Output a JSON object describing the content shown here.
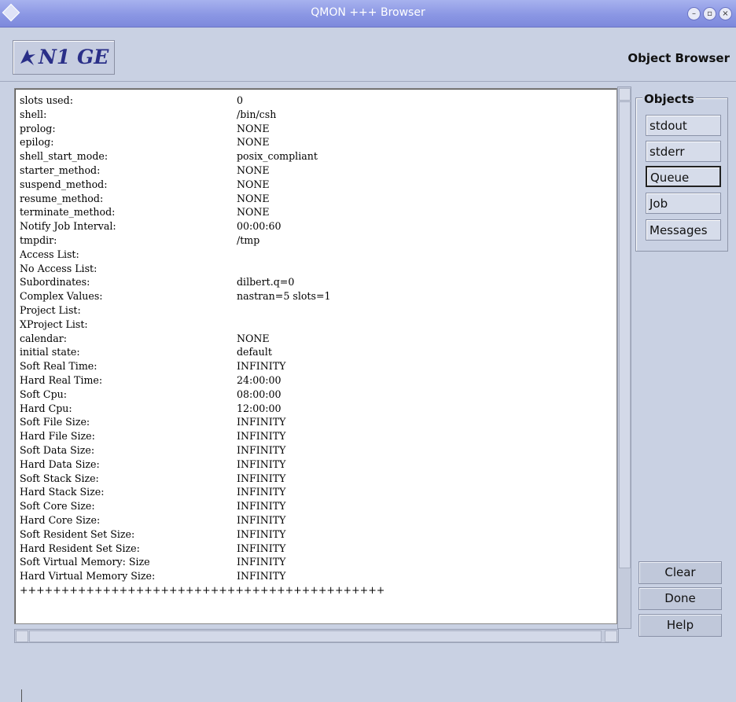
{
  "window": {
    "title": "QMON +++ Browser"
  },
  "header": {
    "logo_text": "N1 GE",
    "title": "Object Browser"
  },
  "content": {
    "lines": [
      [
        "slots used:",
        "0"
      ],
      [
        "shell:",
        "/bin/csh"
      ],
      [
        "prolog:",
        "NONE"
      ],
      [
        "epilog:",
        "NONE"
      ],
      [
        "shell_start_mode:",
        "posix_compliant"
      ],
      [
        "starter_method:",
        "NONE"
      ],
      [
        "suspend_method:",
        "NONE"
      ],
      [
        "resume_method:",
        "NONE"
      ],
      [
        "terminate_method:",
        "NONE"
      ],
      [
        "Notify Job Interval:",
        "00:00:60"
      ],
      [
        "tmpdir:",
        "/tmp"
      ],
      [
        "Access List:",
        ""
      ],
      [
        "No Access List:",
        ""
      ],
      [
        "Subordinates:",
        "dilbert.q=0"
      ],
      [
        "Complex Values:",
        "nastran=5 slots=1"
      ],
      [
        "Project List:",
        ""
      ],
      [
        "XProject List:",
        ""
      ],
      [
        "calendar:",
        "NONE"
      ],
      [
        "initial state:",
        "default"
      ],
      [
        "Soft Real Time:",
        "INFINITY"
      ],
      [
        "Hard Real Time:",
        "24:00:00"
      ],
      [
        "Soft Cpu:",
        "08:00:00"
      ],
      [
        "Hard Cpu:",
        "12:00:00"
      ],
      [
        "Soft File Size:",
        "INFINITY"
      ],
      [
        "Hard File Size:",
        "INFINITY"
      ],
      [
        "Soft Data Size:",
        "INFINITY"
      ],
      [
        "Hard Data Size:",
        "INFINITY"
      ],
      [
        "Soft Stack Size:",
        "INFINITY"
      ],
      [
        "Hard Stack Size:",
        "INFINITY"
      ],
      [
        "Soft Core Size:",
        "INFINITY"
      ],
      [
        "Hard Core Size:",
        "INFINITY"
      ],
      [
        "Soft Resident Set Size:",
        "INFINITY"
      ],
      [
        "Hard Resident Set Size:",
        "INFINITY"
      ],
      [
        "Soft Virtual Memory: Size",
        "INFINITY"
      ],
      [
        "Hard Virtual Memory Size:",
        "INFINITY"
      ],
      [
        "++++++++++++++++++++++++++++++++++++++++++++",
        ""
      ]
    ]
  },
  "objects": {
    "label": "Objects",
    "items": [
      "stdout",
      "stderr",
      "Queue",
      "Job",
      "Messages"
    ],
    "selected": "Queue"
  },
  "buttons": {
    "clear": "Clear",
    "done": "Done",
    "help": "Help"
  },
  "colors": {
    "titlebar": "#8b97e4",
    "panel": "#c9d1e3",
    "logo_text": "#2a2f88"
  }
}
